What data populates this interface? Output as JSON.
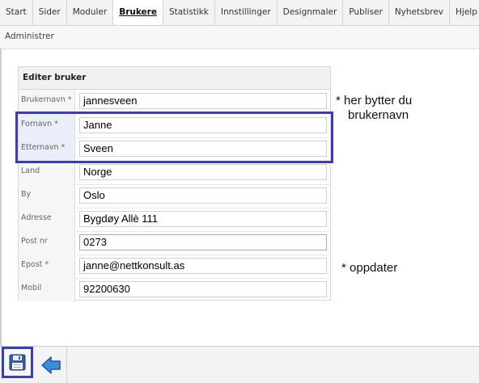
{
  "topnav": {
    "tabs": [
      {
        "label": "Start"
      },
      {
        "label": "Sider"
      },
      {
        "label": "Moduler"
      },
      {
        "label": "Brukere",
        "active": true
      },
      {
        "label": "Statistikk"
      },
      {
        "label": "Innstillinger"
      },
      {
        "label": "Designmaler"
      },
      {
        "label": "Publiser"
      },
      {
        "label": "Nyhetsbrev"
      },
      {
        "label": "Hjelp"
      }
    ]
  },
  "subnav": {
    "label": "Administrer"
  },
  "form": {
    "header": "Editer bruker",
    "fields": [
      {
        "label": "Brukernavn *",
        "value": "jannesveen"
      },
      {
        "label": "Fornavn *",
        "value": "Janne"
      },
      {
        "label": "Etternavn *",
        "value": "Sveen"
      },
      {
        "label": "Land",
        "value": "Norge"
      },
      {
        "label": "By",
        "value": "Oslo"
      },
      {
        "label": "Adresse",
        "value": "Bygdøy Allè 111"
      },
      {
        "label": "Post nr",
        "value": "0273"
      },
      {
        "label": "Epost *",
        "value": "janne@nettkonsult.as"
      },
      {
        "label": "Mobil",
        "value": "92200630"
      }
    ]
  },
  "notes": {
    "username_line1": "* her bytter du",
    "username_line2": "brukernavn",
    "update": "* oppdater"
  },
  "toolbar": {
    "save_icon": "floppy-disk-icon",
    "back_icon": "arrow-left-icon"
  },
  "colors": {
    "highlight": "#3b3db5",
    "back_arrow": "#3a8fd8"
  }
}
